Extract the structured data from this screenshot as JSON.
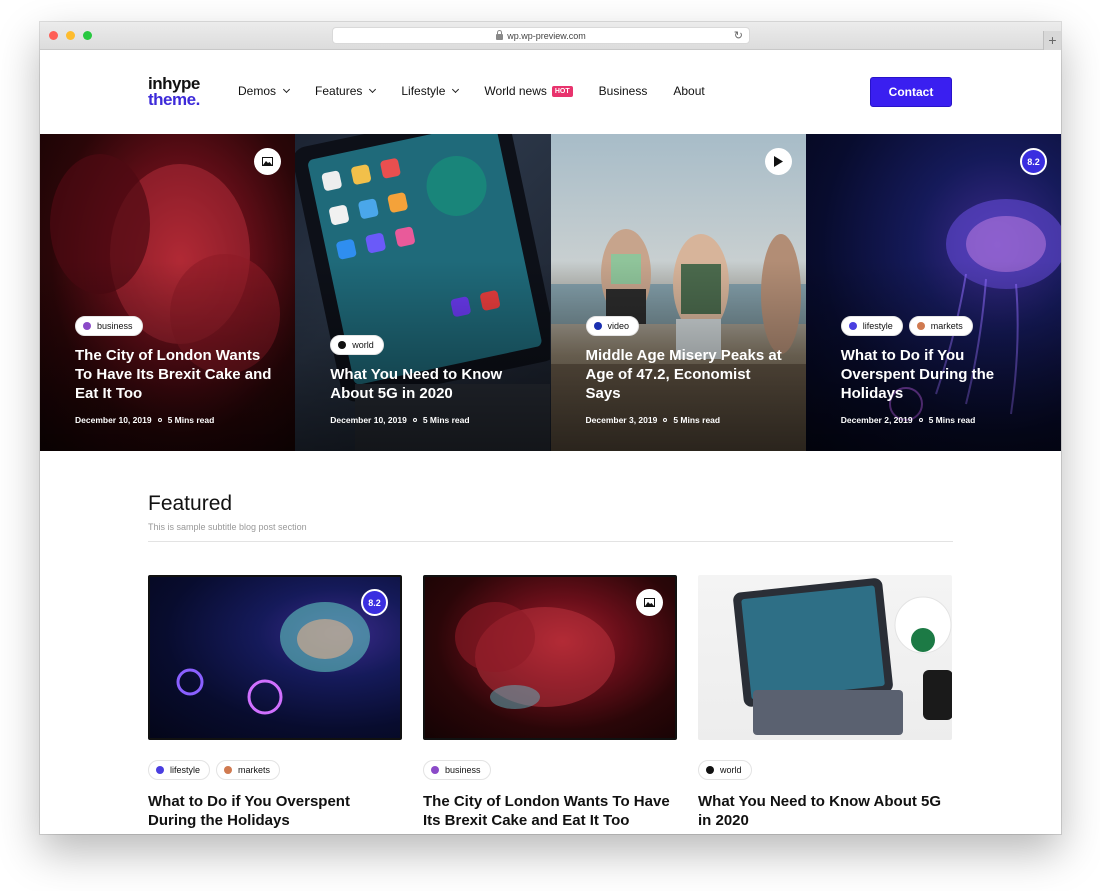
{
  "browser": {
    "url": "wp.wp-preview.com"
  },
  "logo": {
    "line1": "inhype",
    "line2": "theme."
  },
  "nav": {
    "items": [
      {
        "label": "Demos",
        "dropdown": true
      },
      {
        "label": "Features",
        "dropdown": true
      },
      {
        "label": "Lifestyle",
        "dropdown": true
      },
      {
        "label": "World news",
        "badge": "HOT"
      },
      {
        "label": "Business"
      },
      {
        "label": "About"
      }
    ],
    "contact_label": "Contact"
  },
  "hero": [
    {
      "tags": [
        {
          "label": "business",
          "color": "#8b4ac8"
        }
      ],
      "title": "The City of London Wants To Have Its Brexit Cake and Eat It Too",
      "date": "December 10, 2019",
      "read": "5 Mins read",
      "badge": "image"
    },
    {
      "tags": [
        {
          "label": "world",
          "color": "#111111"
        }
      ],
      "title": "What You Need to Know About 5G in 2020",
      "date": "December 10, 2019",
      "read": "5 Mins read"
    },
    {
      "tags": [
        {
          "label": "video",
          "color": "#1a2fb0"
        }
      ],
      "title": "Middle Age Misery Peaks at Age of 47.2, Economist Says",
      "date": "December 3, 2019",
      "read": "5 Mins read",
      "badge": "play"
    },
    {
      "tags": [
        {
          "label": "lifestyle",
          "color": "#4a3ee0"
        },
        {
          "label": "markets",
          "color": "#d07a50"
        }
      ],
      "title": "What to Do if You Overspent During the Holidays",
      "date": "December 2, 2019",
      "read": "5 Mins read",
      "badge": "score",
      "score": "8.2"
    }
  ],
  "featured": {
    "title": "Featured",
    "subtitle": "This is sample subtitle blog post section",
    "cards": [
      {
        "tags": [
          {
            "label": "lifestyle",
            "color": "#4a3ee0"
          },
          {
            "label": "markets",
            "color": "#d07a50"
          }
        ],
        "title": "What to Do if You Overspent During the Holidays",
        "badge": "score",
        "score": "8.2"
      },
      {
        "tags": [
          {
            "label": "business",
            "color": "#8b4ac8"
          }
        ],
        "title": "The City of London Wants To Have Its Brexit Cake and Eat It Too",
        "badge": "image"
      },
      {
        "tags": [
          {
            "label": "world",
            "color": "#111111"
          }
        ],
        "title": "What You Need to Know About 5G in 2020"
      }
    ]
  },
  "colors": {
    "accent": "#3a1ff0",
    "hot": "#e8336d"
  }
}
